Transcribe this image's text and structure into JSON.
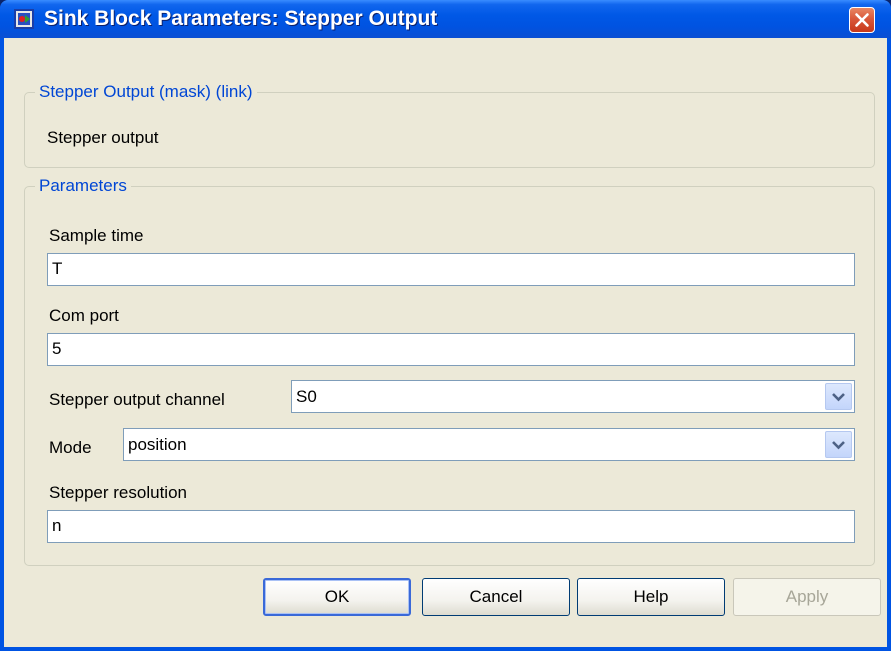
{
  "window": {
    "title": "Sink Block Parameters: Stepper Output"
  },
  "description_group": {
    "legend": "Stepper Output (mask) (link)",
    "text": "Stepper output"
  },
  "parameters_group": {
    "legend": "Parameters",
    "sample_time": {
      "label": "Sample time",
      "value": "T"
    },
    "com_port": {
      "label": "Com port",
      "value": "5"
    },
    "stepper_output_channel": {
      "label": "Stepper output channel",
      "value": "S0"
    },
    "mode": {
      "label": "Mode",
      "value": "position"
    },
    "stepper_resolution": {
      "label": "Stepper resolution",
      "value": "n"
    }
  },
  "buttons": {
    "ok": "OK",
    "cancel": "Cancel",
    "help": "Help",
    "apply": "Apply"
  },
  "icons": {
    "app": "simulink-block-icon",
    "close": "close-icon",
    "dropdown": "chevron-down-icon"
  },
  "colors": {
    "titlebar": "#0054e3",
    "close_button": "#d9583a",
    "dialog_background": "#ece9d8",
    "legend_text": "#0046d5",
    "field_border": "#7f9db9"
  }
}
